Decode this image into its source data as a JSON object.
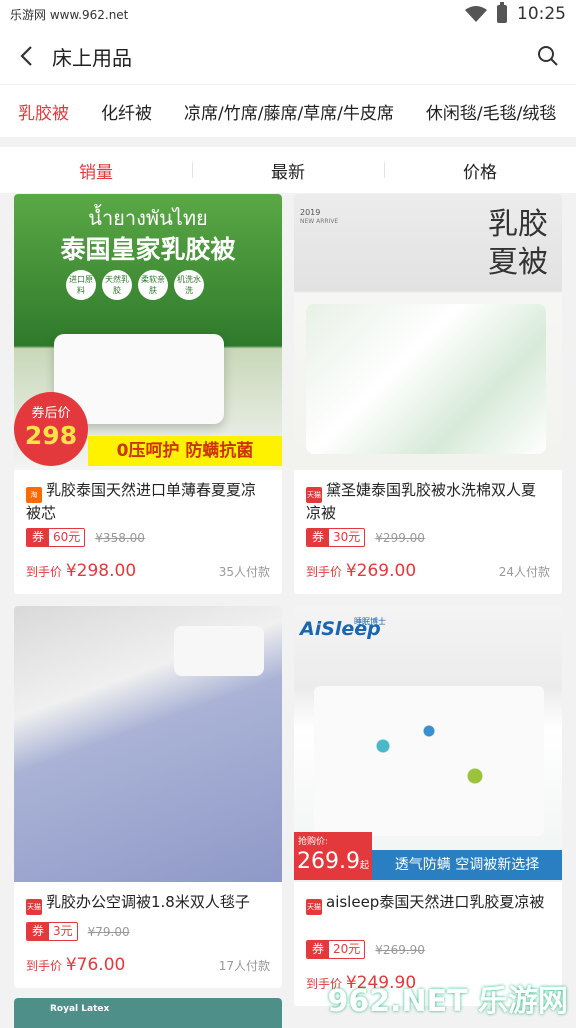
{
  "status": {
    "left": "乐游网 www.962.net",
    "time": "10:25"
  },
  "header": {
    "title": "床上用品"
  },
  "categories": [
    "乳胶被",
    "化纤被",
    "凉席/竹席/藤席/草席/牛皮席",
    "休闲毯/毛毯/绒毯"
  ],
  "sort": [
    "销量",
    "最新",
    "价格"
  ],
  "products": [
    {
      "title": "乳胶泰国天然进口单薄春夏夏凉被芯",
      "shop_badge": "淘",
      "coupon_label": "券",
      "coupon": "60元",
      "original_price": "¥358.00",
      "final_label": "到手价",
      "final_price": "¥298.00",
      "sold": "35人付款",
      "banner": {
        "thai": "น้ำยางพันไทย",
        "headline": "泰国皇家乳胶被",
        "tags": [
          "进口原料",
          "天然乳胶",
          "柔软亲肤",
          "机洗水洗"
        ],
        "coupon_caption": "券后价",
        "coupon_price": "298",
        "slogan": "0压呵护 防螨抗菌"
      }
    },
    {
      "title": "黛圣婕泰国乳胶被水洗棉双人夏凉被",
      "shop_badge": "天猫",
      "coupon_label": "券",
      "coupon": "30元",
      "original_price": "¥299.00",
      "final_label": "到手价",
      "final_price": "¥269.00",
      "sold": "24人付款",
      "banner": {
        "year": "2019",
        "sub": "NEW ARRIVE",
        "big": "乳胶夏被"
      }
    },
    {
      "title": "乳胶办公空调被1.8米双人毯子",
      "shop_badge": "天猫",
      "coupon_label": "券",
      "coupon": "3元",
      "original_price": "¥79.00",
      "final_label": "到手价",
      "final_price": "¥76.00",
      "sold": "17人付款"
    },
    {
      "title": "aisleep泰国天然进口乳胶夏凉被",
      "shop_badge": "天猫",
      "coupon_label": "券",
      "coupon": "20元",
      "original_price": "¥269.90",
      "final_label": "到手价",
      "final_price": "¥249.90",
      "sold": "",
      "banner": {
        "brand": "AiSleep",
        "brand_cn": "睡眠博士",
        "caption": "抢购价:",
        "price": "269.9",
        "unit": "起",
        "slogan": "透气防螨 空调被新选择"
      }
    }
  ],
  "partial_card": {
    "brand": "Royal Latex"
  },
  "watermark": "962.NET 乐游网"
}
